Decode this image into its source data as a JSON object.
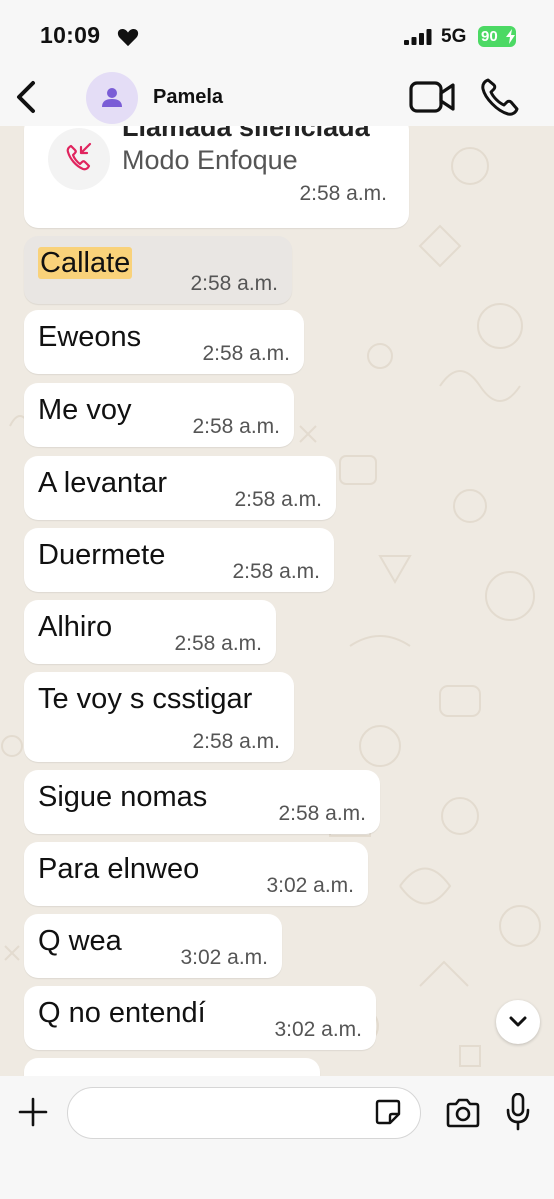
{
  "status_bar": {
    "time": "10:09",
    "network": "5G",
    "battery": "90"
  },
  "header": {
    "contact_name": "Pamela"
  },
  "call_event": {
    "title": "Llamada silenciada",
    "subtitle": "Modo Enfoque",
    "time": "2:58 a.m."
  },
  "messages": [
    {
      "text": "Callate",
      "time": "2:58 a.m."
    },
    {
      "text": "Eweons",
      "time": "2:58 a.m."
    },
    {
      "text": "Me voy",
      "time": "2:58 a.m."
    },
    {
      "text": "A levantar",
      "time": "2:58 a.m."
    },
    {
      "text": "Duermete",
      "time": "2:58 a.m."
    },
    {
      "text": "Alhiro",
      "time": "2:58 a.m."
    },
    {
      "text": "Te voy s csstigar",
      "time": "2:58 a.m."
    },
    {
      "text": "Sigue nomas",
      "time": "2:58 a.m."
    },
    {
      "text": "Para elnweo",
      "time": "3:02 a.m."
    },
    {
      "text": "Q wea",
      "time": "3:02 a.m."
    },
    {
      "text": "Q no entendí",
      "time": "3:02 a.m."
    }
  ],
  "input": {
    "placeholder": ""
  },
  "icons": [
    "heart-icon",
    "signal-icon",
    "back-icon",
    "person-icon",
    "video-call-icon",
    "phone-icon",
    "missed-call-icon",
    "chevron-down-icon",
    "plus-icon",
    "sticker-icon",
    "camera-icon",
    "mic-icon"
  ],
  "colors": {
    "background": "#efeae2",
    "bubble": "#ffffff",
    "highlight": "#f9d27a",
    "battery": "#4cd964",
    "avatar": "#e4ddf6",
    "missed_call": "#e0245e"
  }
}
